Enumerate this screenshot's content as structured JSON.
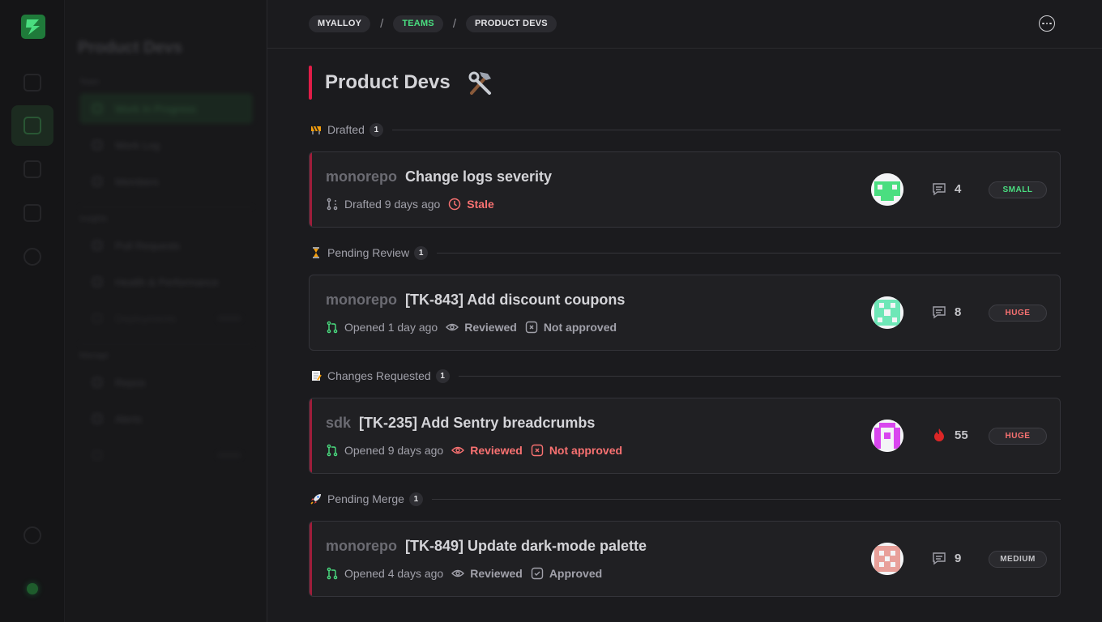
{
  "breadcrumb": {
    "items": [
      "MYALLOY",
      "TEAMS",
      "PRODUCT DEVS"
    ],
    "separator": "/"
  },
  "page": {
    "title": "Product Devs",
    "title_emoji": "hammer-and-wrench"
  },
  "sidebar": {
    "title": "Product Devs",
    "items": [
      "Work In Progress",
      "Work Log",
      "Members",
      "Pull Requests",
      "Health & Performance",
      "Deployments",
      "Repos",
      "Alerts"
    ]
  },
  "groups": [
    {
      "icon": "construction-icon",
      "label": "Drafted",
      "count": "1",
      "card": {
        "repo": "monorepo",
        "title": "Change logs severity",
        "meta": [
          {
            "icon": "branch-draft-icon",
            "text": "Drafted 9 days ago",
            "tone": "muted"
          },
          {
            "icon": "clock-icon",
            "text": "Stale",
            "tone": "red"
          }
        ],
        "stat_icon": "comment-icon",
        "stat": "4",
        "size": "SMALL",
        "size_tone": "green"
      }
    },
    {
      "icon": "hourglass-icon",
      "label": "Pending Review",
      "count": "1",
      "card": {
        "repo": "monorepo",
        "title": "[TK-843] Add discount coupons",
        "meta": [
          {
            "icon": "pull-request-icon",
            "text": "Opened 1 day ago",
            "tone": "muted"
          },
          {
            "icon": "eye-icon",
            "text": "Reviewed",
            "tone": "muted"
          },
          {
            "icon": "x-box-icon",
            "text": "Not approved",
            "tone": "muted"
          }
        ],
        "stat_icon": "comment-icon",
        "stat": "8",
        "size": "HUGE",
        "size_tone": "red"
      }
    },
    {
      "icon": "memo-icon",
      "label": "Changes Requested",
      "count": "1",
      "card": {
        "repo": "sdk",
        "title": "[TK-235] Add Sentry breadcrumbs",
        "meta": [
          {
            "icon": "pull-request-icon",
            "text": "Opened 9 days ago",
            "tone": "muted"
          },
          {
            "icon": "eye-icon",
            "text": "Reviewed",
            "tone": "red"
          },
          {
            "icon": "x-box-icon",
            "text": "Not approved",
            "tone": "red"
          }
        ],
        "stat_icon": "flame-icon",
        "stat": "55",
        "size": "HUGE",
        "size_tone": "red"
      }
    },
    {
      "icon": "rocket-icon",
      "label": "Pending Merge",
      "count": "1",
      "card": {
        "repo": "monorepo",
        "title": "[TK-849] Update dark-mode palette",
        "meta": [
          {
            "icon": "pull-request-icon",
            "text": "Opened 4 days ago",
            "tone": "muted"
          },
          {
            "icon": "eye-icon",
            "text": "Reviewed",
            "tone": "muted"
          },
          {
            "icon": "check-box-icon",
            "text": "Approved",
            "tone": "muted"
          }
        ],
        "stat_icon": "comment-icon",
        "stat": "9",
        "size": "MEDIUM",
        "size_tone": "gray"
      }
    }
  ],
  "colors": {
    "accent_red": "#e11d48",
    "green": "#4ade80",
    "red_text": "#f87171",
    "background": "#1b1b1e",
    "card": "#202023"
  }
}
